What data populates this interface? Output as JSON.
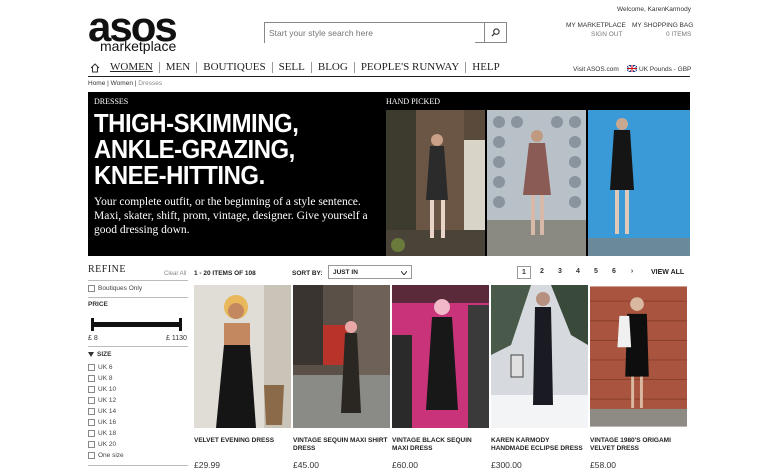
{
  "logo": {
    "brand": "asos",
    "sub": "marketplace"
  },
  "search": {
    "placeholder": "Start your style search here"
  },
  "header": {
    "welcome": "Welcome, KarenKarmody",
    "my_marketplace": "MY MARKETPLACE",
    "sign_out": "SIGN OUT",
    "my_bag": "MY SHOPPING BAG",
    "bag_items": "0 ITEMS",
    "visit": "Visit ASOS.com",
    "currency": "UK Pounds - GBP"
  },
  "nav": [
    "WOMEN",
    "MEN",
    "BOUTIQUES",
    "SELL",
    "BLOG",
    "PEOPLE'S RUNWAY",
    "HELP"
  ],
  "breadcrumb": {
    "home": "Home",
    "women": "Women",
    "current": "Dresses"
  },
  "banner": {
    "label": "DRESSES",
    "headline1": "THIGH-SKIMMING,",
    "headline2": "ANKLE-GRAZING,",
    "headline3": "KNEE-HITTING.",
    "sub": "Your complete outfit, or the beginning of a style sentence. Maxi, skater, shift, prom, vintage, designer. Give yourself a good dressing down.",
    "hand_picked": "HAND PICKED"
  },
  "refine": {
    "title": "REFINE",
    "clear_all": "Clear All",
    "boutiques_only": "Boutiques Only",
    "price_label": "PRICE",
    "price_min": "£ 8",
    "price_max": "£ 1130",
    "price_range_fraction": [
      0.0,
      1.0
    ],
    "size_label": "SIZE",
    "sizes": [
      "UK 6",
      "UK 8",
      "UK 10",
      "UK 12",
      "UK 14",
      "UK 16",
      "UK 18",
      "UK 20",
      "One size"
    ]
  },
  "listing": {
    "count": "1 - 20 ITEMS OF 108",
    "sort_label": "SORT BY:",
    "sort_value": "JUST IN",
    "pages": [
      "1",
      "2",
      "3",
      "4",
      "5",
      "6",
      "›"
    ],
    "current_page": "1",
    "view_all": "VIEW ALL"
  },
  "products": [
    {
      "name": "VELVET EVENING DRESS",
      "price": "£29.99"
    },
    {
      "name": "VINTAGE SEQUIN MAXI SHIRT DRESS",
      "price": "£45.00"
    },
    {
      "name": "VINTAGE BLACK SEQUIN MAXI DRESS",
      "price": "£60.00"
    },
    {
      "name": "KAREN KARMODY HANDMADE ECLIPSE DRESS",
      "price": "£300.00"
    },
    {
      "name": "VINTAGE 1980'S ORIGAMI VELVET DRESS",
      "price": "£58.00"
    }
  ],
  "colors": {
    "accent": "#000000",
    "flag_red": "#cc0000",
    "flag_blue": "#1a3a8a"
  }
}
